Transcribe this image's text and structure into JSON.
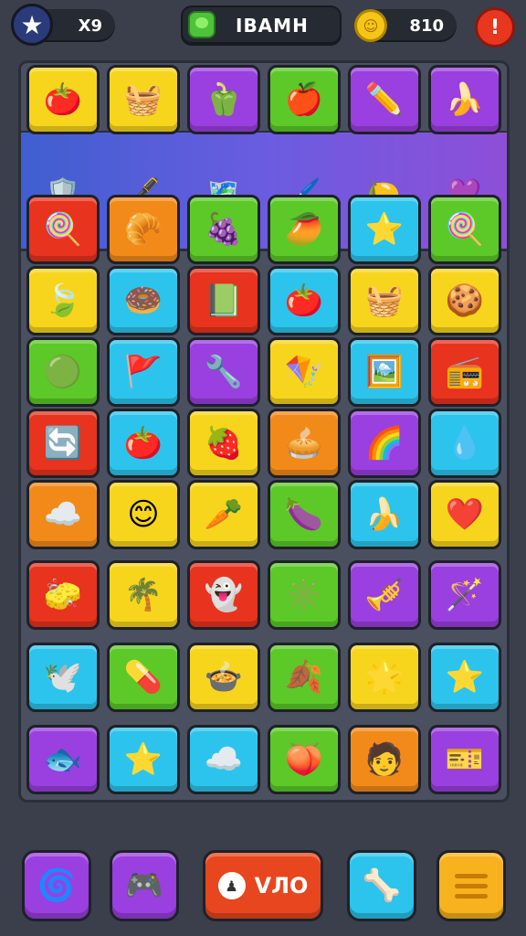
{
  "hud": {
    "lives_value": "X9",
    "level_name": "IBAMH",
    "coins_value": "810",
    "alert_label": "!",
    "icons": {
      "lives": "star-icon",
      "level": "green-gem-icon",
      "coins": "coin-icon",
      "alert": "alert-icon"
    }
  },
  "band": {
    "tiles": [
      {
        "name": "tomato-face",
        "glyph": "🍅",
        "color": "yellow"
      },
      {
        "name": "basket",
        "glyph": "🧺",
        "color": "yellow"
      },
      {
        "name": "red-pepper",
        "glyph": "🫑",
        "color": "purple"
      },
      {
        "name": "apple",
        "glyph": "🍎",
        "color": "green"
      },
      {
        "name": "pencil-leaf",
        "glyph": "✏️",
        "color": "purple"
      },
      {
        "name": "banana",
        "glyph": "🍌",
        "color": "purple"
      }
    ],
    "minis": [
      {
        "name": "shield-badge",
        "glyph": "🛡️"
      },
      {
        "name": "feather-pen",
        "glyph": "🖋️"
      },
      {
        "name": "map-tile",
        "glyph": "🗺️"
      },
      {
        "name": "paintbrush",
        "glyph": "🖌️"
      },
      {
        "name": "lemon",
        "glyph": "🍋"
      },
      {
        "name": "purple-blob",
        "glyph": "💜"
      }
    ]
  },
  "grid": [
    [
      {
        "name": "cotton-candy",
        "glyph": "🍭",
        "color": "red"
      },
      {
        "name": "croissant",
        "glyph": "🥐",
        "color": "orange"
      },
      {
        "name": "grapes",
        "glyph": "🍇",
        "color": "green"
      },
      {
        "name": "mango",
        "glyph": "🥭",
        "color": "green"
      },
      {
        "name": "star",
        "glyph": "⭐",
        "color": "cyan"
      },
      {
        "name": "lollipop",
        "glyph": "🍭",
        "color": "green"
      }
    ],
    [
      {
        "name": "green-leaf",
        "glyph": "🍃",
        "color": "yellow"
      },
      {
        "name": "donut",
        "glyph": "🍩",
        "color": "cyan"
      },
      {
        "name": "book",
        "glyph": "📗",
        "color": "red"
      },
      {
        "name": "tomato",
        "glyph": "🍅",
        "color": "cyan"
      },
      {
        "name": "picnic-basket",
        "glyph": "🧺",
        "color": "yellow"
      },
      {
        "name": "cookie-face",
        "glyph": "🍪",
        "color": "yellow"
      }
    ],
    [
      {
        "name": "green-blob",
        "glyph": "🟢",
        "color": "green"
      },
      {
        "name": "flag-card",
        "glyph": "🚩",
        "color": "cyan"
      },
      {
        "name": "tools",
        "glyph": "🔧",
        "color": "purple"
      },
      {
        "name": "kite",
        "glyph": "🪁",
        "color": "yellow"
      },
      {
        "name": "picture-card",
        "glyph": "🖼️",
        "color": "cyan"
      },
      {
        "name": "radio",
        "glyph": "📻",
        "color": "red"
      }
    ],
    [
      {
        "name": "purple-arrow",
        "glyph": "🔄",
        "color": "red"
      },
      {
        "name": "tomato",
        "glyph": "🍅",
        "color": "cyan"
      },
      {
        "name": "strawberry",
        "glyph": "🍓",
        "color": "yellow"
      },
      {
        "name": "pie",
        "glyph": "🥧",
        "color": "orange"
      },
      {
        "name": "rainbow-box",
        "glyph": "🌈",
        "color": "purple"
      },
      {
        "name": "blue-blob",
        "glyph": "💧",
        "color": "cyan"
      }
    ],
    [
      {
        "name": "cloud",
        "glyph": "☁️",
        "color": "orange"
      },
      {
        "name": "smiley",
        "glyph": "😊",
        "color": "yellow"
      },
      {
        "name": "carrot",
        "glyph": "🥕",
        "color": "yellow"
      },
      {
        "name": "eggplant",
        "glyph": "🍆",
        "color": "green"
      },
      {
        "name": "banana",
        "glyph": "🍌",
        "color": "cyan"
      },
      {
        "name": "heart",
        "glyph": "❤️",
        "color": "yellow"
      }
    ],
    [
      {
        "name": "sponge",
        "glyph": "🧽",
        "color": "red"
      },
      {
        "name": "palm-tree",
        "glyph": "🌴",
        "color": "yellow"
      },
      {
        "name": "ghost-face",
        "glyph": "👻",
        "color": "red"
      },
      {
        "name": "green-splat",
        "glyph": "✳️",
        "color": "green"
      },
      {
        "name": "flute",
        "glyph": "🎺",
        "color": "purple"
      },
      {
        "name": "magic-wand",
        "glyph": "🪄",
        "color": "purple"
      }
    ],
    [
      {
        "name": "white-bird",
        "glyph": "🕊️",
        "color": "cyan"
      },
      {
        "name": "lozenge",
        "glyph": "💊",
        "color": "green"
      },
      {
        "name": "pot",
        "glyph": "🍲",
        "color": "yellow"
      },
      {
        "name": "purple-leaf",
        "glyph": "🍂",
        "color": "green"
      },
      {
        "name": "sun-star",
        "glyph": "🌟",
        "color": "yellow"
      },
      {
        "name": "red-star",
        "glyph": "⭐",
        "color": "cyan"
      }
    ],
    [
      {
        "name": "green-fish",
        "glyph": "🐟",
        "color": "purple"
      },
      {
        "name": "orange-star",
        "glyph": "⭐",
        "color": "cyan"
      },
      {
        "name": "white-cloud",
        "glyph": "☁️",
        "color": "cyan"
      },
      {
        "name": "peach",
        "glyph": "🍑",
        "color": "green"
      },
      {
        "name": "head-face",
        "glyph": "🧑",
        "color": "orange"
      },
      {
        "name": "ticket-card",
        "glyph": "🎫",
        "color": "purple"
      }
    ]
  ],
  "bottom": {
    "spiral_icon": "🌀",
    "game_icon": "🎮",
    "play_label": "VЛO",
    "play_disc": "♟",
    "bone_icon": "🦴",
    "menu_icon": "menu-icon"
  },
  "colors": {
    "yellow": "#f7d51d",
    "purple": "#9a3fe0",
    "green": "#5cc928",
    "red": "#e8331e",
    "orange": "#f28a1a",
    "cyan": "#2cc4ec"
  }
}
